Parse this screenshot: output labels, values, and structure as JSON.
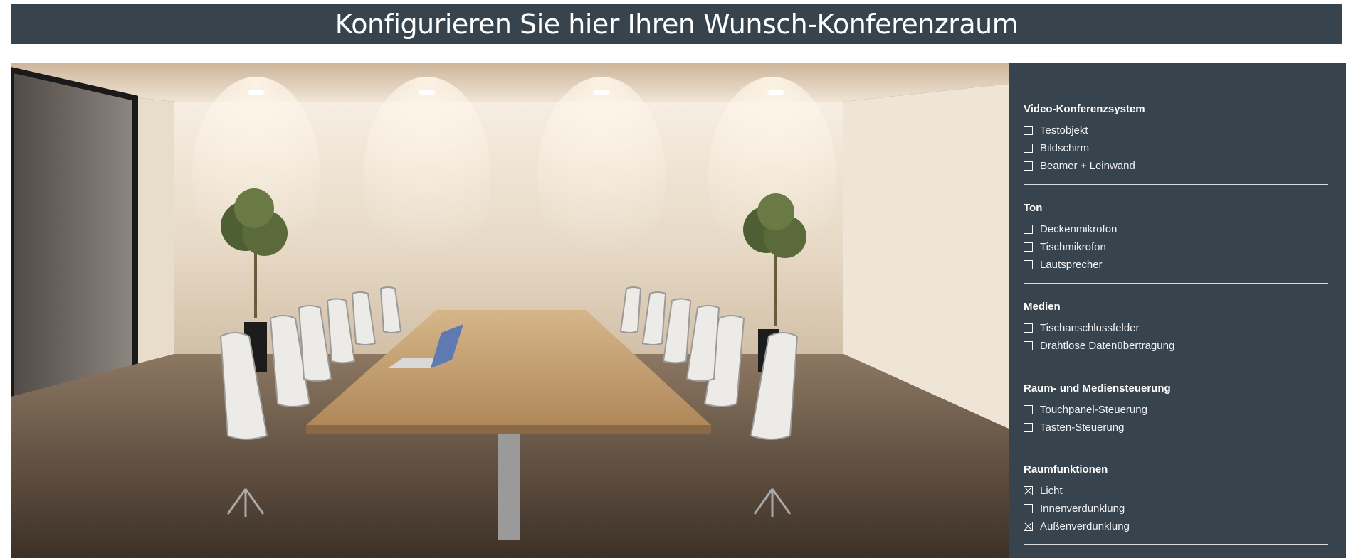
{
  "header": {
    "title": "Konfigurieren Sie hier Ihren Wunsch-Konferenzraum"
  },
  "scene": {
    "alt": "Konferenzraum"
  },
  "sections": [
    {
      "title": "Video-Konferenzsystem",
      "options": [
        {
          "label": "Testobjekt",
          "checked": false
        },
        {
          "label": "Bildschirm",
          "checked": false
        },
        {
          "label": "Beamer + Leinwand",
          "checked": false
        }
      ]
    },
    {
      "title": "Ton",
      "options": [
        {
          "label": "Deckenmikrofon",
          "checked": false
        },
        {
          "label": "Tischmikrofon",
          "checked": false
        },
        {
          "label": "Lautsprecher",
          "checked": false
        }
      ]
    },
    {
      "title": "Medien",
      "options": [
        {
          "label": "Tischanschlussfelder",
          "checked": false
        },
        {
          "label": "Drahtlose Datenübertragung",
          "checked": false
        }
      ]
    },
    {
      "title": "Raum- und Mediensteuerung",
      "options": [
        {
          "label": "Touchpanel-Steuerung",
          "checked": false
        },
        {
          "label": "Tasten-Steuerung",
          "checked": false
        }
      ]
    },
    {
      "title": "Raumfunktionen",
      "options": [
        {
          "label": "Licht",
          "checked": true
        },
        {
          "label": "Innenverdunklung",
          "checked": false
        },
        {
          "label": "Außenverdunklung",
          "checked": true
        }
      ]
    }
  ]
}
